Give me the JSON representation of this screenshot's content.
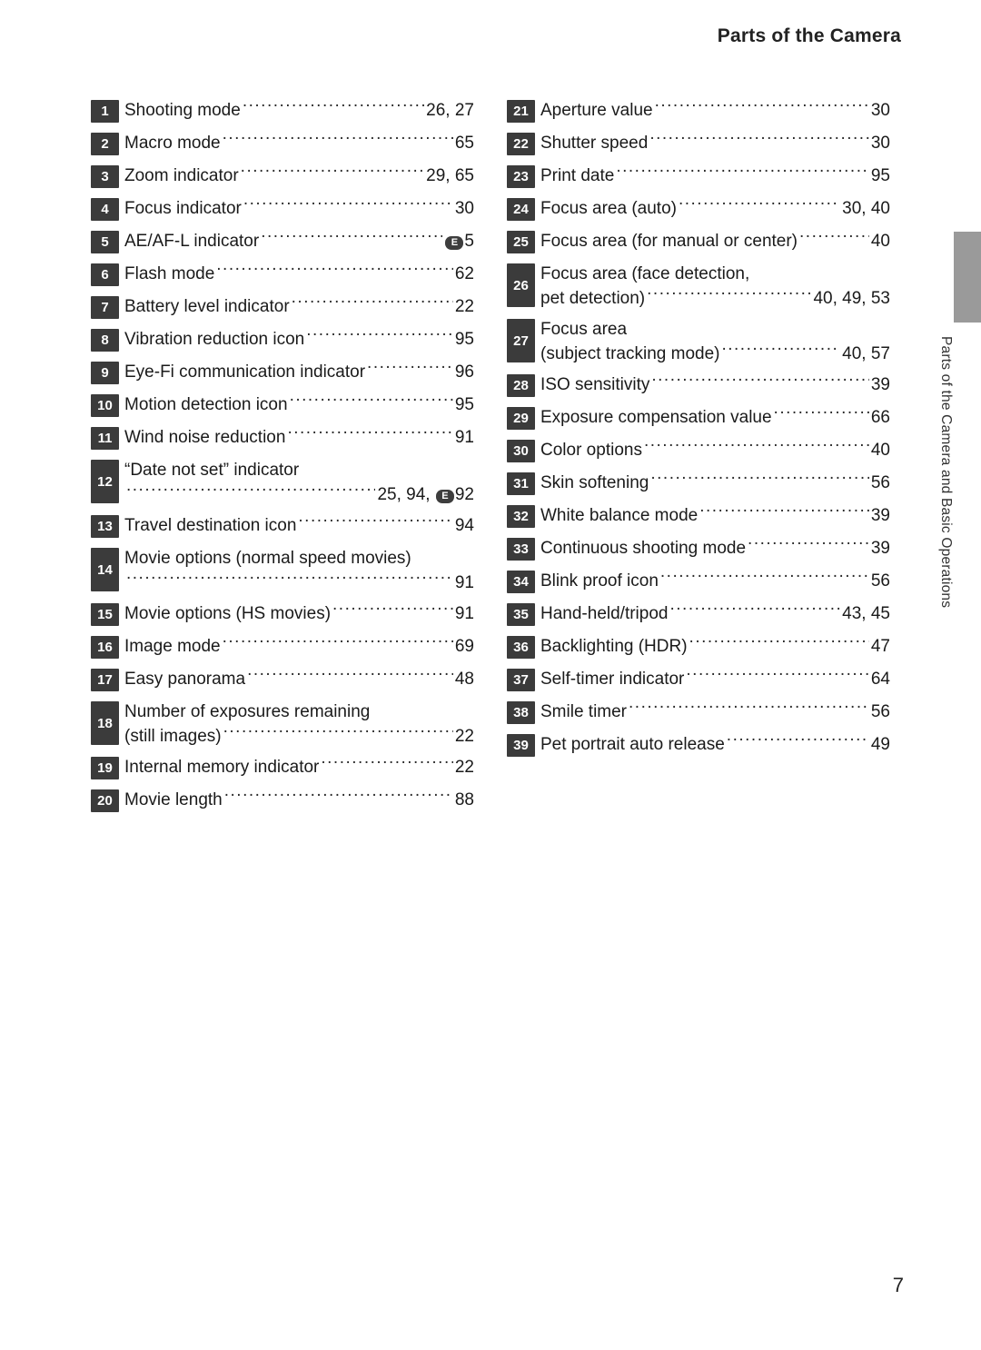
{
  "header": {
    "title": "Parts of the Camera"
  },
  "side": {
    "label": "Parts of the Camera and Basic Operations"
  },
  "page": {
    "number": "7"
  },
  "left_column": [
    {
      "num": "1",
      "label": "Shooting mode",
      "page": "26, 27"
    },
    {
      "num": "2",
      "label": "Macro mode",
      "page": "65"
    },
    {
      "num": "3",
      "label": "Zoom indicator",
      "page": "29, 65"
    },
    {
      "num": "4",
      "label": "Focus indicator",
      "page": "30"
    },
    {
      "num": "5",
      "label": "AE/AF-L indicator",
      "page": "5",
      "page_prefix_symbol": "E"
    },
    {
      "num": "6",
      "label": "Flash mode",
      "page": "62"
    },
    {
      "num": "7",
      "label": "Battery level indicator",
      "page": "22"
    },
    {
      "num": "8",
      "label": "Vibration reduction icon",
      "page": "95"
    },
    {
      "num": "9",
      "label": "Eye-Fi communication indicator",
      "page": "96"
    },
    {
      "num": "10",
      "label": "Motion detection icon",
      "page": "95"
    },
    {
      "num": "11",
      "label": "Wind noise reduction",
      "page": "91"
    },
    {
      "num": "12",
      "label": "“Date not set” indicator",
      "page": "25, 94,",
      "page2": "92",
      "page2_symbol": "E",
      "two_line": true
    },
    {
      "num": "13",
      "label": "Travel destination icon",
      "page": "94"
    },
    {
      "num": "14",
      "label": "Movie options (normal speed movies)",
      "page": "91",
      "two_line": true
    },
    {
      "num": "15",
      "label": "Movie options (HS movies)",
      "page": "91"
    },
    {
      "num": "16",
      "label": "Image mode",
      "page": "69"
    },
    {
      "num": "17",
      "label": "Easy panorama",
      "page": "48"
    },
    {
      "num": "18",
      "label": "Number of exposures remaining",
      "label2": "(still images)",
      "page": "22",
      "two_line": true
    },
    {
      "num": "19",
      "label": "Internal memory indicator",
      "page": "22"
    },
    {
      "num": "20",
      "label": "Movie length",
      "page": "88"
    }
  ],
  "right_column": [
    {
      "num": "21",
      "label": "Aperture value",
      "page": "30"
    },
    {
      "num": "22",
      "label": "Shutter speed",
      "page": "30"
    },
    {
      "num": "23",
      "label": "Print date",
      "page": "95"
    },
    {
      "num": "24",
      "label": "Focus area (auto)",
      "page": "30, 40"
    },
    {
      "num": "25",
      "label": "Focus area (for manual or center)",
      "page": "40"
    },
    {
      "num": "26",
      "label": "Focus area (face detection,",
      "label2": "pet detection)",
      "page": "40, 49, 53",
      "two_line": true
    },
    {
      "num": "27",
      "label": "Focus area",
      "label2": "(subject tracking mode)",
      "page": "40, 57",
      "two_line": true
    },
    {
      "num": "28",
      "label": "ISO sensitivity",
      "page": "39"
    },
    {
      "num": "29",
      "label": "Exposure compensation value",
      "page": "66"
    },
    {
      "num": "30",
      "label": "Color options",
      "page": "40"
    },
    {
      "num": "31",
      "label": "Skin softening",
      "page": "56"
    },
    {
      "num": "32",
      "label": "White balance mode",
      "page": "39"
    },
    {
      "num": "33",
      "label": "Continuous shooting mode",
      "page": "39"
    },
    {
      "num": "34",
      "label": "Blink proof icon",
      "page": "56"
    },
    {
      "num": "35",
      "label": "Hand-held/tripod",
      "page": "43, 45"
    },
    {
      "num": "36",
      "label": "Backlighting (HDR)",
      "page": "47"
    },
    {
      "num": "37",
      "label": "Self-timer indicator",
      "page": "64"
    },
    {
      "num": "38",
      "label": "Smile timer",
      "page": "56"
    },
    {
      "num": "39",
      "label": "Pet portrait auto release",
      "page": "49"
    }
  ]
}
